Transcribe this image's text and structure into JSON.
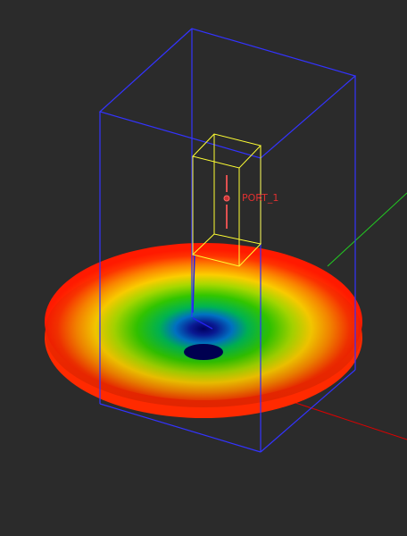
{
  "port": {
    "label": "PORT_1"
  },
  "colors": {
    "background": "#2b2b2b",
    "bounding_box": "#3333ff",
    "port_box": "#ffff33",
    "port_marker": "#e05050",
    "port_label": "#e03030",
    "axis_x": "#dd0000",
    "axis_y": "#22cc22",
    "axis_z": "#1a1acc"
  },
  "icons": {
    "port_marker": "port-dipole-icon"
  },
  "radiation_pattern": {
    "colormap": [
      "blue",
      "cyan",
      "green",
      "yellow",
      "orange",
      "red"
    ]
  }
}
